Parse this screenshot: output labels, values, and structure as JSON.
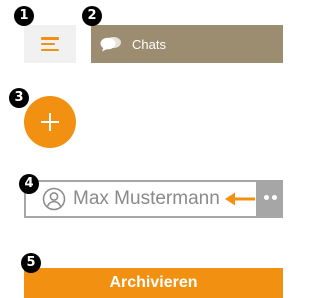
{
  "badges": [
    "1",
    "2",
    "3",
    "4",
    "5"
  ],
  "menu": {
    "icon": "hamburger-menu-icon"
  },
  "chats_tab": {
    "icon": "chat-bubbles-icon",
    "label": "Chats"
  },
  "add_button": {
    "icon": "plus-icon"
  },
  "contact": {
    "icon": "person-icon",
    "name": "Max Mustermann",
    "pointer_icon": "arrow-left-icon",
    "more_icon": "more-dots-icon"
  },
  "archive_button": {
    "label": "Archivieren"
  },
  "colors": {
    "accent": "#f29111",
    "tab_background": "#9c8d71",
    "row_border": "#a6a6a6",
    "menu_background": "#f1f1f1",
    "badge": "#000000"
  }
}
